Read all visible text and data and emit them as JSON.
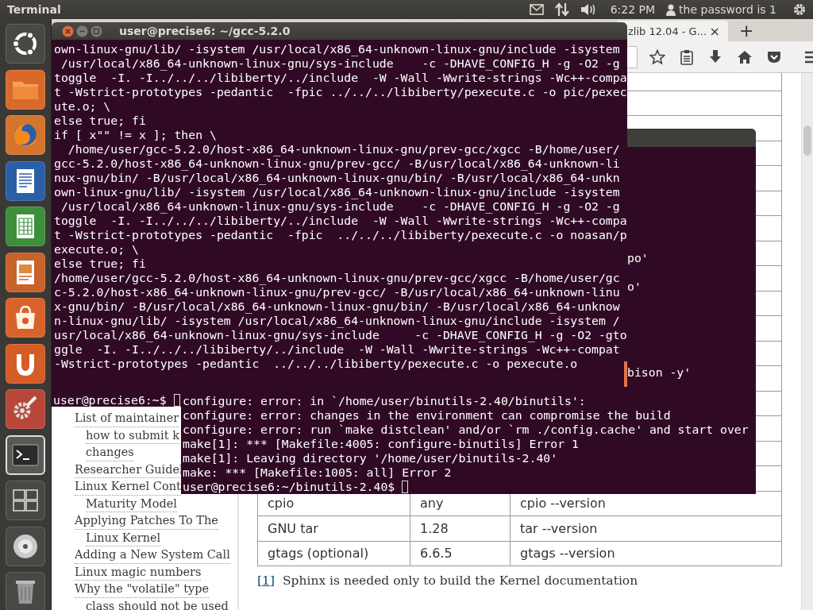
{
  "top_panel": {
    "app_title": "Terminal",
    "clock": "6:22 PM",
    "user": "the password is 1"
  },
  "browser": {
    "tab": {
      "title": "zlib 12.04 - G...",
      "close": "×"
    },
    "new_tab": "+",
    "sidebar": {
      "items": [
        {
          "lines": [
            "List of maintainer",
            "how to submit k",
            "changes"
          ]
        },
        {
          "lines": [
            "Researcher Guidel"
          ]
        },
        {
          "lines": [
            "Linux Kernel Cont",
            "Maturity Model"
          ]
        },
        {
          "lines": [
            "Applying Patches To The",
            "Linux Kernel"
          ]
        },
        {
          "lines": [
            "Adding a New System Call"
          ]
        },
        {
          "lines": [
            "Linux magic numbers"
          ]
        },
        {
          "lines": [
            "Why the \"volatile\" type",
            "class should not be used"
          ]
        }
      ]
    },
    "table": {
      "rows": [
        [
          "cpio",
          "any",
          "cpio --version"
        ],
        [
          "GNU tar",
          "1.28",
          "tar --version"
        ],
        [
          "gtags (optional)",
          "6.6.5",
          "gtags --version"
        ]
      ]
    },
    "footnote": {
      "ref": "[1]",
      "text": "Sphinx is needed only to build the Kernel documentation"
    }
  },
  "terminal_back": {
    "lines": [
      "user@precise6:~$"
    ]
  },
  "terminal_middle": {
    "edge_fragments": [
      "po'",
      "o'",
      "bison -y'"
    ],
    "lines": [
      "configure: error: in `/home/user/binutils-2.40/binutils':",
      "configure: error: changes in the environment can compromise the build",
      "configure: error: run `make distclean' and/or `rm ./config.cache' and start over",
      "make[1]: *** [Makefile:4005: configure-binutils] Error 1",
      "make[1]: Leaving directory '/home/user/binutils-2.40'",
      "make: *** [Makefile:1005: all] Error 2",
      "user@precise6:~/binutils-2.40$"
    ]
  },
  "terminal_front": {
    "title": "user@precise6: ~/gcc-5.2.0",
    "lines": [
      "own-linux-gnu/lib/ -isystem /usr/local/x86_64-unknown-linux-gnu/include -isystem",
      " /usr/local/x86_64-unknown-linux-gnu/sys-include    -c -DHAVE_CONFIG_H -g -O2 -g",
      "toggle  -I. -I../../../libiberty/../include  -W -Wall -Wwrite-strings -Wc++-compa",
      "t -Wstrict-prototypes -pedantic  -fpic ../../../libiberty/pexecute.c -o pic/pexec",
      "ute.o; \\",
      "else true; fi",
      "if [ x\"\" != x ]; then \\",
      "  /home/user/gcc-5.2.0/host-x86_64-unknown-linux-gnu/prev-gcc/xgcc -B/home/user/",
      "gcc-5.2.0/host-x86_64-unknown-linux-gnu/prev-gcc/ -B/usr/local/x86_64-unknown-li",
      "nux-gnu/bin/ -B/usr/local/x86_64-unknown-linux-gnu/bin/ -B/usr/local/x86_64-unkn",
      "own-linux-gnu/lib/ -isystem /usr/local/x86_64-unknown-linux-gnu/include -isystem",
      " /usr/local/x86_64-unknown-linux-gnu/sys-include    -c -DHAVE_CONFIG_H -g -O2 -g",
      "toggle  -I. -I../../../libiberty/../include  -W -Wall -Wwrite-strings -Wc++-compa",
      "t -Wstrict-prototypes -pedantic  -fpic  ../../../libiberty/pexecute.c -o noasan/p",
      "execute.o; \\",
      "else true; fi",
      "/home/user/gcc-5.2.0/host-x86_64-unknown-linux-gnu/prev-gcc/xgcc -B/home/user/gc",
      "c-5.2.0/host-x86_64-unknown-linux-gnu/prev-gcc/ -B/usr/local/x86_64-unknown-linu",
      "x-gnu/bin/ -B/usr/local/x86_64-unknown-linux-gnu/bin/ -B/usr/local/x86_64-unknow",
      "n-linux-gnu/lib/ -isystem /usr/local/x86_64-unknown-linux-gnu/include -isystem /",
      "usr/local/x86_64-unknown-linux-gnu/sys-include     -c -DHAVE_CONFIG_H -g -O2 -gto",
      "ggle  -I. -I../../../libiberty/../include  -W -Wall -Wwrite-strings -Wc++-compat",
      "-Wstrict-prototypes -pedantic  ../../../libiberty/pexecute.c -o pexecute.o"
    ]
  }
}
